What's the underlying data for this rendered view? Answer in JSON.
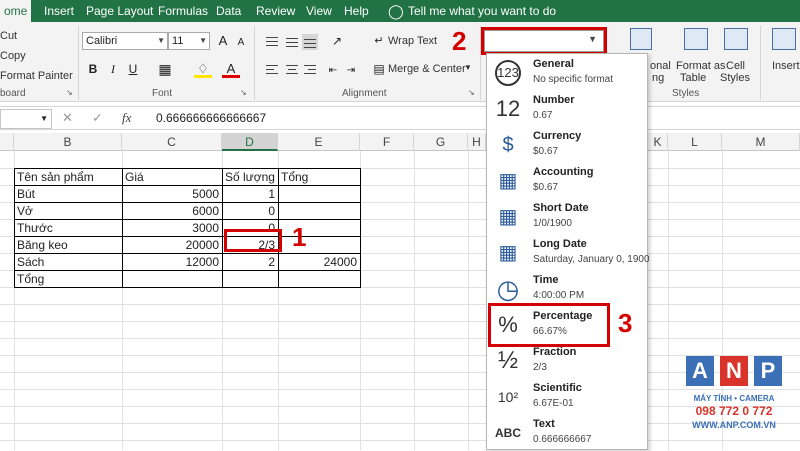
{
  "tabs": [
    "ome",
    "Insert",
    "Page Layout",
    "Formulas",
    "Data",
    "Review",
    "View",
    "Help"
  ],
  "tell_me": "Tell me what you want to do",
  "clipboard": {
    "cut": "Cut",
    "copy": "Copy",
    "painter": "Format Painter",
    "group": "board"
  },
  "font": {
    "name": "Calibri",
    "size": "11",
    "bold": "B",
    "italic": "I",
    "underline": "U",
    "group": "Font"
  },
  "alignment": {
    "wrap": "Wrap Text",
    "merge": "Merge & Center",
    "group": "Alignment"
  },
  "styles": {
    "conditional": "onal",
    "conditional2": "ng",
    "format_table": "Format as",
    "format_table2": "Table",
    "cell_styles": "Cell",
    "cell_styles2": "Styles",
    "group": "Styles"
  },
  "cells_group": {
    "insert": "Insert"
  },
  "formula_bar": {
    "cancel": "✕",
    "enter": "✓",
    "fx": "fx",
    "value": "0.666666666666667"
  },
  "columns": [
    "B",
    "C",
    "D",
    "E",
    "F",
    "G",
    "H",
    "I",
    "J",
    "K",
    "L",
    "M"
  ],
  "selected_column": "D",
  "table": {
    "headers": [
      "Tên sản phẩm",
      "Giá",
      "Số lượng",
      "Tổng"
    ],
    "rows": [
      {
        "name": "Bút",
        "price": "5000",
        "qty": "1",
        "total": ""
      },
      {
        "name": "Vở",
        "price": "6000",
        "qty": "0",
        "total": ""
      },
      {
        "name": "Thước",
        "price": "3000",
        "qty": "0",
        "total": ""
      },
      {
        "name": "Băng keo",
        "price": "20000",
        "qty": "2/3",
        "total": ""
      },
      {
        "name": "Sách",
        "price": "12000",
        "qty": "2",
        "total": "24000"
      },
      {
        "name": "Tổng",
        "price": "",
        "qty": "",
        "total": ""
      }
    ]
  },
  "number_format": {
    "current": "",
    "options": [
      {
        "icon": "clock-123-icon",
        "glyph": "123",
        "name": "General",
        "example": "No specific format"
      },
      {
        "icon": "number-12-icon",
        "glyph": "12",
        "name": "Number",
        "example": "0.67"
      },
      {
        "icon": "currency-icon",
        "glyph": "$",
        "name": "Currency",
        "example": "$0.67"
      },
      {
        "icon": "accounting-icon",
        "glyph": "▦",
        "name": "Accounting",
        "example": " $0.67"
      },
      {
        "icon": "short-date-icon",
        "glyph": "▦",
        "name": "Short Date",
        "example": "1/0/1900"
      },
      {
        "icon": "long-date-icon",
        "glyph": "▦",
        "name": "Long Date",
        "example": "Saturday, January 0, 1900"
      },
      {
        "icon": "time-clock-icon",
        "glyph": "◷",
        "name": "Time",
        "example": "4:00:00 PM"
      },
      {
        "icon": "percent-icon",
        "glyph": "%",
        "name": "Percentage",
        "example": "66.67%"
      },
      {
        "icon": "fraction-icon",
        "glyph": "½",
        "name": "Fraction",
        "example": " 2/3"
      },
      {
        "icon": "scientific-icon",
        "glyph": "10²",
        "name": "Scientific",
        "example": "6.67E-01"
      },
      {
        "icon": "text-abc-icon",
        "glyph": "ABC",
        "name": "Text",
        "example": "0.666666667"
      }
    ]
  },
  "annotations": {
    "step1": "1",
    "step2": "2",
    "step3": "3"
  },
  "watermark": {
    "letters": [
      "A",
      "N",
      "P"
    ],
    "line1": "MÁY TÍNH • CAMERA",
    "line2": "098 772 0 772",
    "line3": "WWW.ANP.COM.VN"
  },
  "colors": {
    "excel_green": "#217346",
    "annotation_red": "#d40000",
    "anp_blue": "#3b6fb6",
    "anp_red": "#d9342b"
  }
}
